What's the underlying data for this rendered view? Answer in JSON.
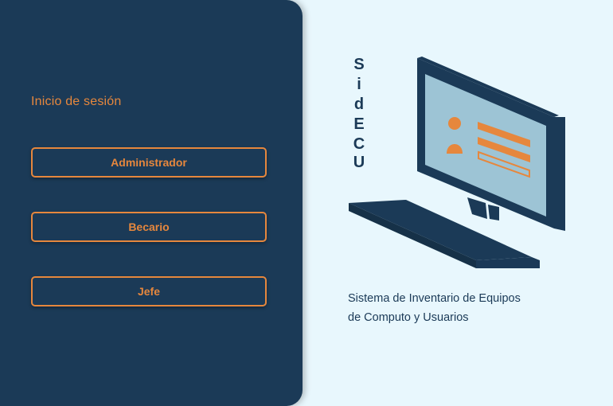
{
  "login": {
    "title": "Inicio de sesión",
    "buttons": [
      "Administrador",
      "Becario",
      "Jefe"
    ]
  },
  "logo": {
    "letters": [
      "S",
      "i",
      "d",
      "E",
      "C",
      "U"
    ]
  },
  "description": {
    "line1": "Sistema de Inventario de Equipos",
    "line2": "de Computo y Usuarios"
  },
  "colors": {
    "panel": "#1b3a57",
    "accent": "#e6873d",
    "background": "#e8f7fd",
    "screen": "#9dc4d5"
  }
}
